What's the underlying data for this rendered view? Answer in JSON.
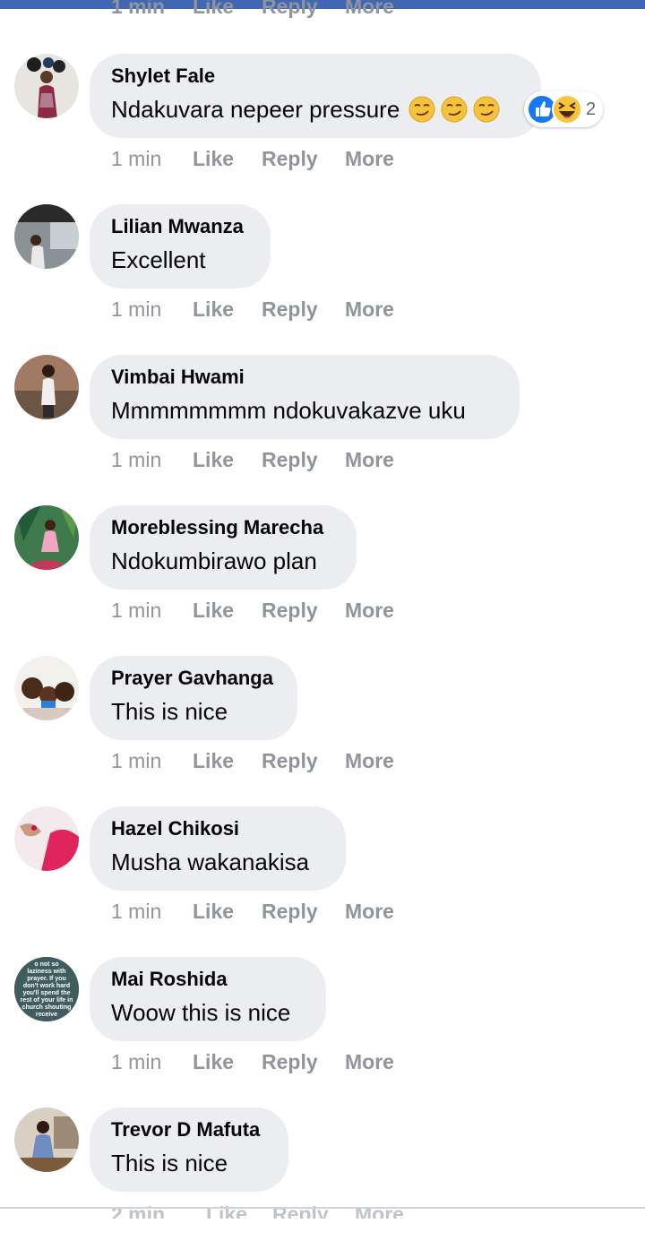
{
  "colors": {
    "bubble": "#ebedf0",
    "meta": "#90949c",
    "brand_bar": "#4267b2",
    "like_blue": "#1877f2"
  },
  "top_cutoff": {
    "time": "1 min",
    "like": "Like",
    "reply": "Reply",
    "more": "More"
  },
  "comments": [
    {
      "author": "Shylet Fale",
      "text": "Ndakuvara nepeer pressure",
      "emojis": [
        "smirk",
        "smirk",
        "smirk"
      ],
      "reactions": {
        "types": [
          "like",
          "haha"
        ],
        "count": "2"
      },
      "time": "1 min",
      "like": "Like",
      "reply": "Reply",
      "more": "More"
    },
    {
      "author": "Lilian Mwanza",
      "text": "Excellent",
      "time": "1 min",
      "like": "Like",
      "reply": "Reply",
      "more": "More"
    },
    {
      "author": "Vimbai Hwami",
      "text": "Mmmmmmmm ndokuvakazve uku",
      "time": "1 min",
      "like": "Like",
      "reply": "Reply",
      "more": "More"
    },
    {
      "author": "Moreblessing Marecha",
      "text": "Ndokumbirawo plan",
      "time": "1 min",
      "like": "Like",
      "reply": "Reply",
      "more": "More"
    },
    {
      "author": "Prayer Gavhanga",
      "text": "This is nice",
      "time": "1 min",
      "like": "Like",
      "reply": "Reply",
      "more": "More"
    },
    {
      "author": "Hazel Chikosi",
      "text": "Musha wakanakisa",
      "time": "1 min",
      "like": "Like",
      "reply": "Reply",
      "more": "More"
    },
    {
      "author": "Mai Roshida",
      "text": "Woow this is nice",
      "avatar_text": [
        "o not so",
        "laziness with",
        "prayer. If you",
        "don't work hard",
        "you'll spend the",
        "rest of your life in",
        "church shouting",
        "receive"
      ],
      "time": "1 min",
      "like": "Like",
      "reply": "Reply",
      "more": "More"
    },
    {
      "author": "Trevor D Mafuta",
      "text": "This is nice",
      "time": "2 min",
      "like": "Like",
      "reply": "Reply",
      "more": "More"
    }
  ]
}
